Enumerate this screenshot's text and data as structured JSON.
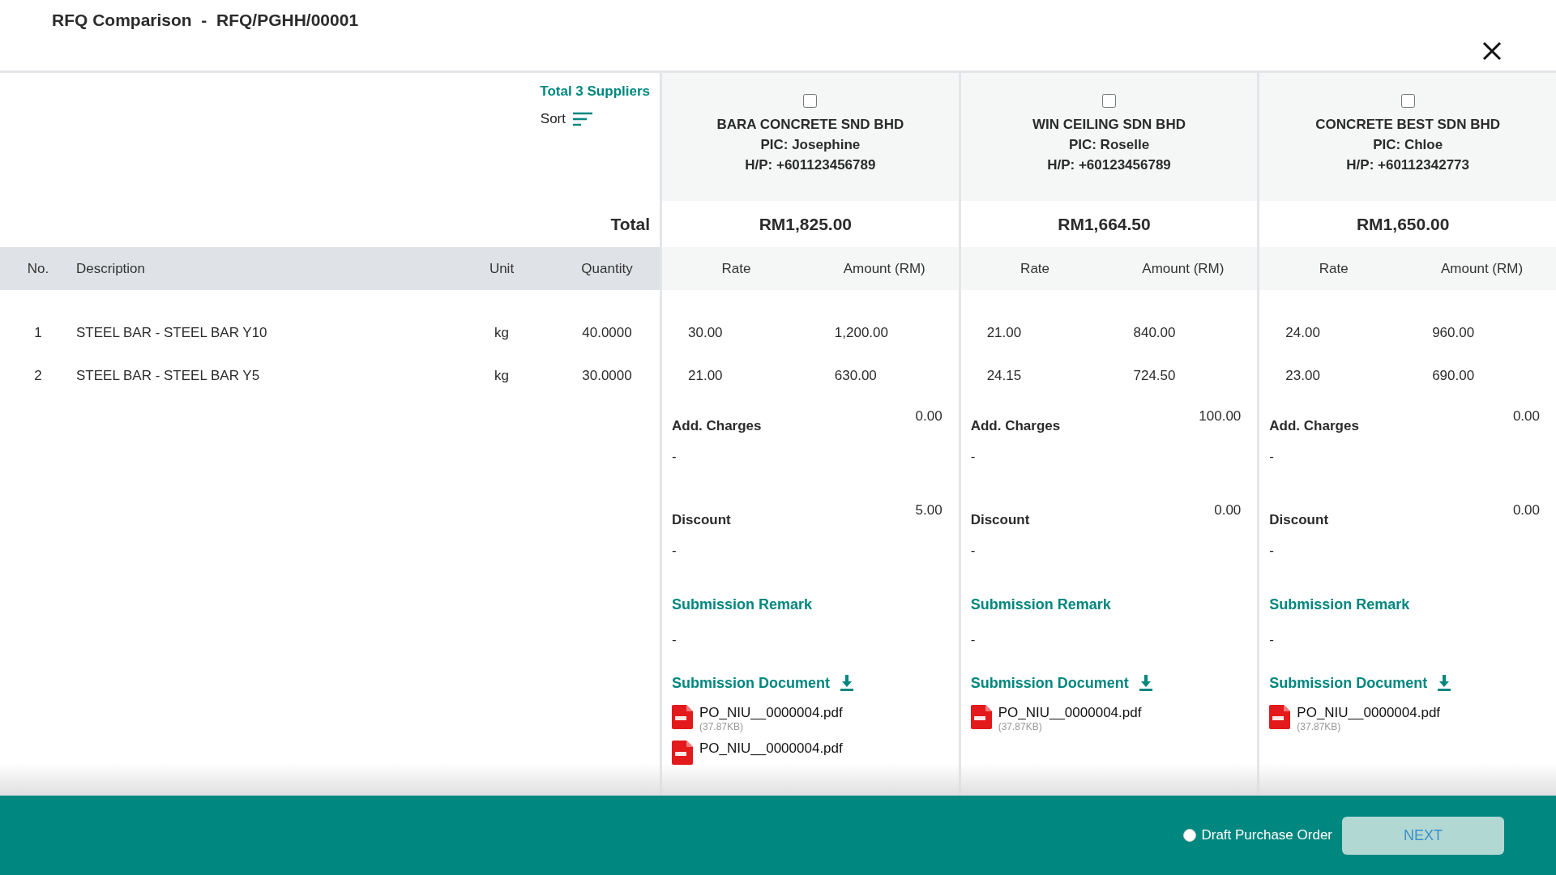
{
  "title": "RFQ Comparison  -  RFQ/PGHH/00001",
  "summary": {
    "suppliers_count": "Total 3 Suppliers",
    "sort_label": "Sort",
    "total_label": "Total"
  },
  "columns": {
    "no": "No.",
    "description": "Description",
    "unit": "Unit",
    "quantity": "Quantity"
  },
  "items": [
    {
      "no": "1",
      "description": "STEEL BAR - STEEL BAR Y10",
      "unit": "kg",
      "quantity": "40.0000"
    },
    {
      "no": "2",
      "description": "STEEL BAR - STEEL BAR Y5",
      "unit": "kg",
      "quantity": "30.0000"
    }
  ],
  "suppliers": [
    {
      "selected": false,
      "name": "BARA CONCRETE SND BHD",
      "pic": "PIC: Josephine",
      "hp": "H/P: +601123456789",
      "total": "RM1,825.00",
      "rate_label": "Rate",
      "amount_label": "Amount (RM)",
      "prices": [
        {
          "rate": "30.00",
          "amount": "1,200.00"
        },
        {
          "rate": "21.00",
          "amount": "630.00"
        }
      ],
      "add_charges": {
        "label": "Add. Charges",
        "value": "0.00",
        "note": "-"
      },
      "discount": {
        "label": "Discount",
        "value": "5.00",
        "note": "-"
      },
      "remark": {
        "label": "Submission Remark",
        "text": "-"
      },
      "document": {
        "label": "Submission Document",
        "files": [
          {
            "name": "PO_NIU__0000004.pdf",
            "size": "(37.87KB)"
          },
          {
            "name": "PO_NIU__0000004.pdf"
          }
        ]
      }
    },
    {
      "selected": false,
      "name": "WIN CEILING SDN BHD",
      "pic": "PIC: Roselle",
      "hp": "H/P: +60123456789",
      "total": "RM1,664.50",
      "rate_label": "Rate",
      "amount_label": "Amount (RM)",
      "prices": [
        {
          "rate": "21.00",
          "amount": "840.00"
        },
        {
          "rate": "24.15",
          "amount": "724.50"
        }
      ],
      "add_charges": {
        "label": "Add. Charges",
        "value": "100.00",
        "note": "-"
      },
      "discount": {
        "label": "Discount",
        "value": "0.00",
        "note": "-"
      },
      "remark": {
        "label": "Submission Remark",
        "text": "-"
      },
      "document": {
        "label": "Submission Document",
        "files": [
          {
            "name": "PO_NIU__0000004.pdf",
            "size": "(37.87KB)"
          }
        ]
      }
    },
    {
      "selected": false,
      "name": "CONCRETE BEST SDN BHD",
      "pic": "PIC: Chloe",
      "hp": "H/P: +60112342773",
      "total": "RM1,650.00",
      "rate_label": "Rate",
      "amount_label": "Amount (RM)",
      "prices": [
        {
          "rate": "24.00",
          "amount": "960.00"
        },
        {
          "rate": "23.00",
          "amount": "690.00"
        }
      ],
      "add_charges": {
        "label": "Add. Charges",
        "value": "0.00",
        "note": "-"
      },
      "discount": {
        "label": "Discount",
        "value": "0.00",
        "note": "-"
      },
      "remark": {
        "label": "Submission Remark",
        "text": "-"
      },
      "document": {
        "label": "Submission Document",
        "files": [
          {
            "name": "PO_NIU__0000004.pdf",
            "size": "(37.87KB)"
          }
        ]
      }
    }
  ],
  "footer": {
    "draft": {
      "label": "Draft Purchase Order",
      "selected": false
    },
    "next": {
      "label": "NEXT",
      "disabled": true
    }
  }
}
